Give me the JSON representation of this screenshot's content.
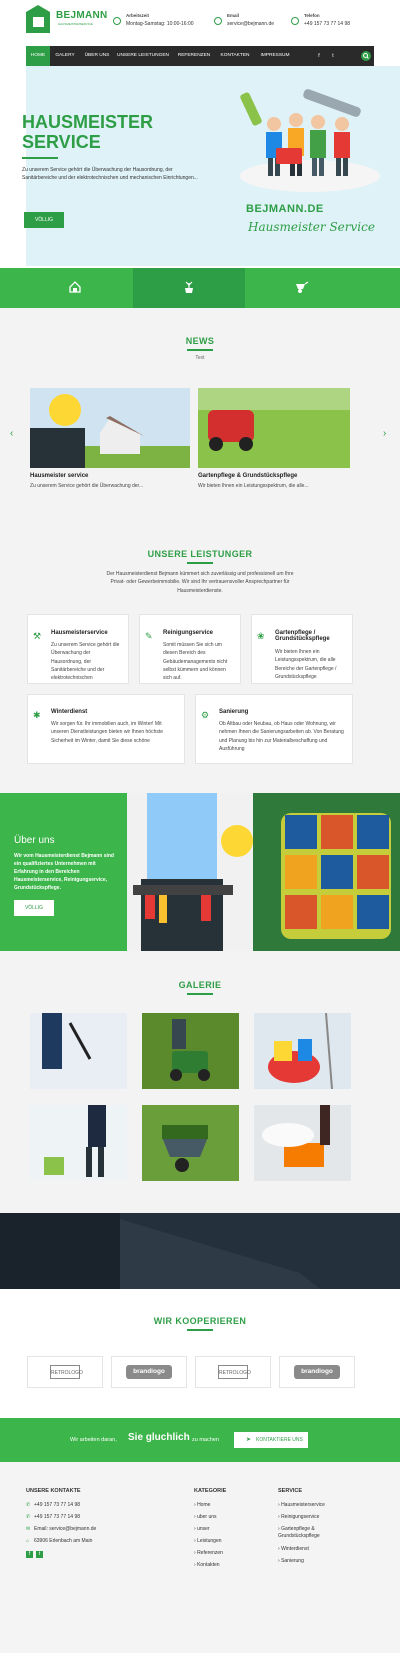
{
  "brand": {
    "name": "BEJMANN",
    "tagline": "HAUSMEISTERSERVICE"
  },
  "topinfo": [
    {
      "label": "Arbeitszeit",
      "value": "Montag-Samstag: 10:00-16:00",
      "icon": "clock-icon"
    },
    {
      "label": "Email",
      "value": "service@bejmann.de",
      "icon": "mail-icon"
    },
    {
      "label": "Telefon",
      "value": "+49 157 73 77 14 98",
      "icon": "phone-icon"
    }
  ],
  "nav": [
    "HOME",
    "GALERY",
    "ÜBER UNS",
    "UNSERE LEISTUNGEN",
    "REFERENZEN",
    "KONTAKTEN",
    "IMPRESSUM"
  ],
  "hero": {
    "title": "HAUSMEISTER SERVICE",
    "text": "Zu unserem Service gehört die Überwachung der Hausordnung, der Sanitärbereiche und der elektrotechnischen und mechanischen Einrichtungen...",
    "button": "VÖLLIG",
    "brand_line1": "BEJMANN.DE",
    "brand_line2": "Hausmeister Service"
  },
  "news": {
    "title": "NEWS",
    "sub": "Text",
    "items": [
      {
        "title": "Hausmeister service",
        "text": "Zu unserem Service gehört die Überwachung der..."
      },
      {
        "title": "Gartenpflege & Grundstückspflege",
        "text": "Wir bieten Ihnen ein Leistungsspektrum, die alle..."
      }
    ]
  },
  "services": {
    "title": "UNSERE LEISTUNGER",
    "intro": "Der Hausmeisterdienst Bejmann kümmert sich zuverlässig und professionell um Ihre Privat- oder Gewerbeimmobilie. Wir sind Ihr vertrauensvoller Ansprechpartner für Hausmeisterdienste.",
    "cards": [
      {
        "title": "Hausmeisterservice",
        "text": "Zu unserem Service gehört die Überwachung der Hausordnung, der Sanitärbereiche und der elektrotechnischen"
      },
      {
        "title": "Reinigungservice",
        "text": "Somit müssen Sie sich um diesen Bereich des Gebäudemanagements nicht selbst kümmern und können sich auf."
      },
      {
        "title": "Gartenpflege / Grundstückspflege",
        "text": "Wir bieten Ihnen ein Leistungsspektrum, die alle Bereiche der Gartenpflege / Grundstückspflege"
      },
      {
        "title": "Winterdienst",
        "text": "Wir sorgen für. Ihr immobilien auch, im Winter! Mit unseren Dienstleistungen bieten wir Ihnen höchste Sicherheit im Winter, damit Sie diese schöne"
      },
      {
        "title": "Sanierung",
        "text": "Ob Altbau oder Neubau, ob Haus oder Wohnung, wir nehmen Ihnen die Sanierungsarbeiten ab. Von Beratung und Planung bis hin zur Materialbeschaffung und Ausführung"
      }
    ]
  },
  "about": {
    "title": "Über uns",
    "text": "Wir vom Hausmeisterdienst Bejmann sind ein qualifiziertes Unternehmen mit Erfahrung in den Bereichen Hausmeisterservice, Reinigungservice, Grundstückspflege.",
    "button": "VÖLLIG"
  },
  "gallery": {
    "title": "GALERIE"
  },
  "partners": {
    "title": "WIR KOOPERIEREN",
    "logos": [
      "RETROLOGO",
      "brandlogo",
      "RETROLOGO",
      "brandlogo"
    ]
  },
  "cta": {
    "pre": "Wir arbeiten daran,",
    "main": "Sie gluchlich",
    "post": "zu machen",
    "button": "KONTAKTIERE UNS"
  },
  "footer": {
    "contacts_title": "UNSERE KONTAKTE",
    "contacts": [
      "+49 157 73 77 14 98",
      "+49 157 73 77 14 98",
      "Email: service@bejmann.de",
      "63906 Erlenbach am Main"
    ],
    "kategorie_title": "KATEGORIE",
    "kategorie": [
      "Home",
      "uber uns",
      "unser",
      "Leistungen",
      "Referenzen",
      "Kontakten"
    ],
    "service_title": "SERVICE",
    "service": [
      "Hausmeisterservice",
      "Reinigungservice",
      "Gartenpflege & Grundstückspflege",
      "Winterdienst",
      "Sanierung"
    ]
  },
  "colors": {
    "primary": "#2e9e46",
    "primary_light": "#3cb54a",
    "dark": "#2a2a2a"
  }
}
